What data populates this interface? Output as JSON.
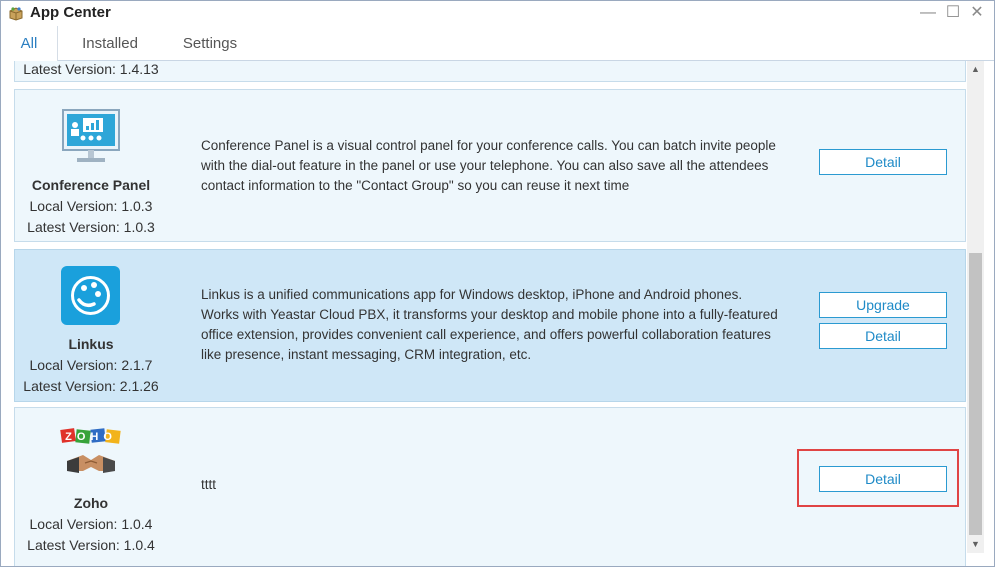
{
  "window": {
    "title": "App Center"
  },
  "tabs": [
    {
      "label": "All",
      "active": true
    },
    {
      "label": "Installed",
      "active": false
    },
    {
      "label": "Settings",
      "active": false
    }
  ],
  "partial_top": {
    "latest": "Latest Version: 1.4.13"
  },
  "apps": [
    {
      "name": "Conference Panel",
      "icon": "conference-panel-icon",
      "local": "Local Version: 1.0.3",
      "latest": "Latest Version: 1.0.3",
      "description": "Conference Panel is a visual control panel for your conference calls. You can batch invite people with the dial-out feature in the panel or use your telephone. You can also save all the attendees contact information to the \"Contact Group\" so you can reuse it next time",
      "detail_label": "Detail"
    },
    {
      "name": "Linkus",
      "icon": "linkus-icon",
      "local": "Local Version: 2.1.7",
      "latest": "Latest Version: 2.1.26",
      "description": "Linkus is a unified communications app for Windows desktop, iPhone and Android phones. Works with Yeastar Cloud PBX, it transforms your desktop and mobile phone into a fully-featured office extension, provides convenient call experience, and offers powerful collaboration features like presence, instant messaging, CRM integration, etc.",
      "upgrade_label": "Upgrade",
      "detail_label": "Detail"
    },
    {
      "name": "Zoho",
      "icon": "zoho-icon",
      "logo_text": "ZOHO",
      "local": "Local Version: 1.0.4",
      "latest": "Latest Version: 1.0.4",
      "description": "tttt",
      "detail_label": "Detail"
    }
  ],
  "colors": {
    "accent": "#2b7fc1",
    "button_border": "#2b9ad1",
    "card_bg": "#eef7fc",
    "card_highlight_bg": "#cfe7f7",
    "highlight_box": "#e04444"
  }
}
